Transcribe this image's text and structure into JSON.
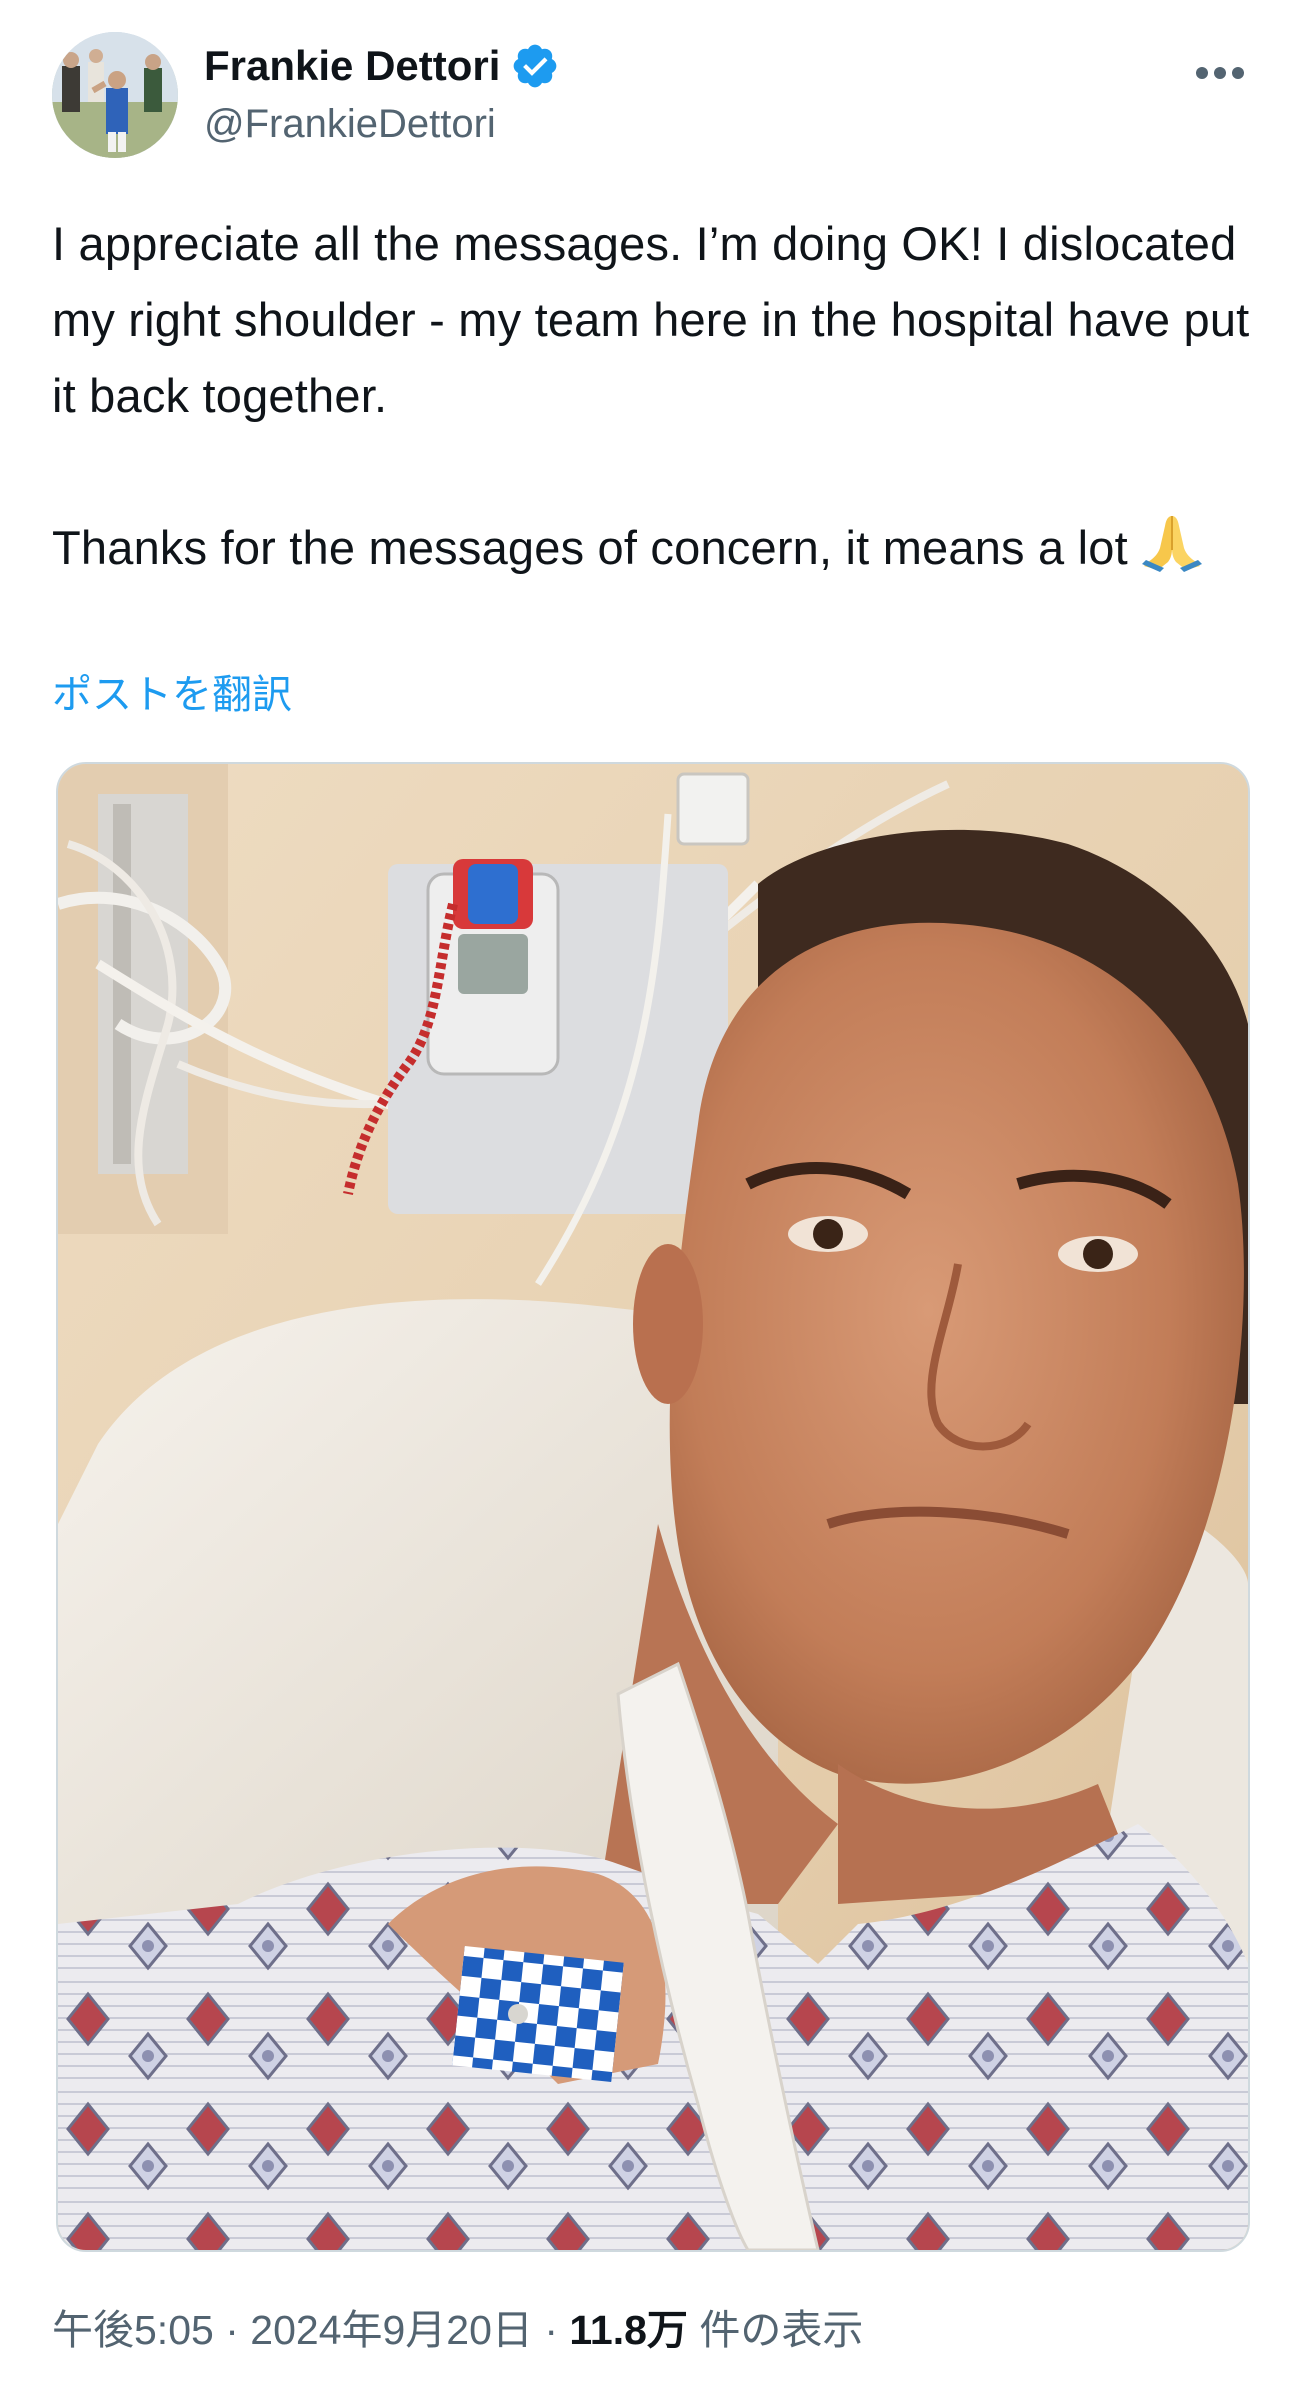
{
  "author": {
    "display_name": "Frankie Dettori",
    "handle": "@FrankieDettori",
    "verified": true
  },
  "tweet": {
    "paragraphs": [
      "I appreciate all the messages. I’m doing OK! I dislocated my right shoulder - my team here in the hospital have put it back together.",
      "Thanks for the messages of concern, it means a lot"
    ],
    "emoji": "folded-hands-icon",
    "translate_label": "ポストを翻訳"
  },
  "media": {
    "subject": "man-in-hospital-bed-photo"
  },
  "meta": {
    "time": "午後5:05",
    "separator": "·",
    "date": "2024年9月20日",
    "views_count": "11.8万",
    "views_label": "件の表示"
  },
  "colors": {
    "text": "#0f1419",
    "secondary": "#536471",
    "link": "#1d9bf0",
    "verified": "#1d9bf0",
    "border": "#cfd9de"
  },
  "icons": {
    "more": "more-horizontal-icon",
    "verified": "verified-badge-icon"
  }
}
